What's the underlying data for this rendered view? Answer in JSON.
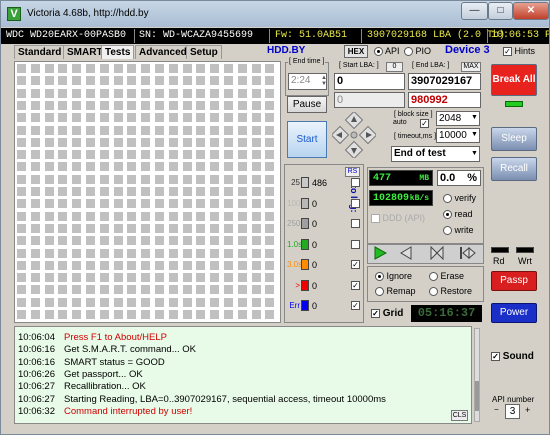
{
  "window": {
    "title": "Victoria 4.68b, http://hdd.by",
    "icon": "V"
  },
  "titlebar": {
    "minimize": "—",
    "maximize": "□",
    "close": "✕"
  },
  "infobar": {
    "model": "WDC WD20EARX-00PASB0",
    "serial": "SN: WD-WCAZA9455699",
    "firmware": "Fw: 51.0AB51",
    "lba": "3907029168 LBA (2.0 Tb)",
    "time": "10:06:53 PM"
  },
  "tabs": [
    "Standard",
    "SMART",
    "Tests",
    "Advanced",
    "Setup"
  ],
  "toolbar": {
    "site": "HDD.BY",
    "hex": "HEX",
    "api_label": "API",
    "pio_label": "PIO",
    "device": "Device 3",
    "hints": "Hints"
  },
  "test": {
    "end_time_label": "[ End time ]",
    "end_time": "2:24",
    "start_lba_label": "[ Start LBA: ]",
    "start_lba_extra": "0",
    "start_lba": "0",
    "start_lba_current": "0",
    "end_lba_label": "[ End LBA: ]",
    "max_label": "MAX",
    "end_lba": "3907029167",
    "current_lba": "980992",
    "pause": "Pause",
    "start": "Start",
    "block_size_label": "[ block size ]",
    "block_auto": "auto",
    "block_size": "2048",
    "timeout_label": "[ timeout,ms ]",
    "timeout": "10000",
    "end_action": "End of test"
  },
  "side": {
    "break_all": "Break All",
    "sleep": "Sleep",
    "recall": "Recall",
    "rd": "Rd",
    "wrt": "Wrt",
    "passp": "Passp",
    "power": "Power",
    "sound": "Sound",
    "api_number_label": "API number",
    "api_number": "3"
  },
  "stats": {
    "rs": "RS",
    "to_log": "to log:",
    "rows": [
      {
        "label": "25",
        "value": "486",
        "color": "#c8c8c8",
        "log": false
      },
      {
        "label": "100",
        "value": "0",
        "color": "#b8b8b8",
        "log": false
      },
      {
        "label": "250",
        "value": "0",
        "color": "#a0a0a0",
        "log": false
      },
      {
        "label": "1.0s",
        "value": "0",
        "color": "#22aa22",
        "log": false
      },
      {
        "label": "3.0s",
        "value": "0",
        "color": "#ff8c00",
        "log": true
      },
      {
        "label": ">",
        "value": "0",
        "color": "#ee0000",
        "log": true
      },
      {
        "label": "Err",
        "value": "0",
        "color": "#0000ee",
        "log": true
      }
    ]
  },
  "readout": {
    "mb": "477",
    "mb_unit": "MB",
    "percent": "0.0",
    "percent_unit": "%",
    "speed": "102809",
    "speed_unit": "kB/s",
    "ddd": "DDD (API)",
    "verify": "verify",
    "read": "read",
    "write": "write",
    "ignore": "Ignore",
    "erase": "Erase",
    "remap": "Remap",
    "restore": "Restore",
    "grid": "Grid",
    "elapsed": "05:16:37"
  },
  "log": [
    {
      "time": "10:06:04",
      "msg": "Press F1 to About/HELP",
      "red": true
    },
    {
      "time": "10:06:16",
      "msg": "Get S.M.A.R.T. command... OK",
      "red": false
    },
    {
      "time": "10:06:16",
      "msg": "SMART status = GOOD",
      "red": false
    },
    {
      "time": "10:06:26",
      "msg": "Get passport... OK",
      "red": false
    },
    {
      "time": "10:06:27",
      "msg": "Recallibration... OK",
      "red": false
    },
    {
      "time": "10:06:27",
      "msg": "Starting Reading, LBA=0..3907029167, sequential access, timeout 10000ms",
      "red": false
    },
    {
      "time": "10:06:32",
      "msg": "Command interrupted by user!",
      "red": true
    }
  ],
  "cls": "CLS"
}
